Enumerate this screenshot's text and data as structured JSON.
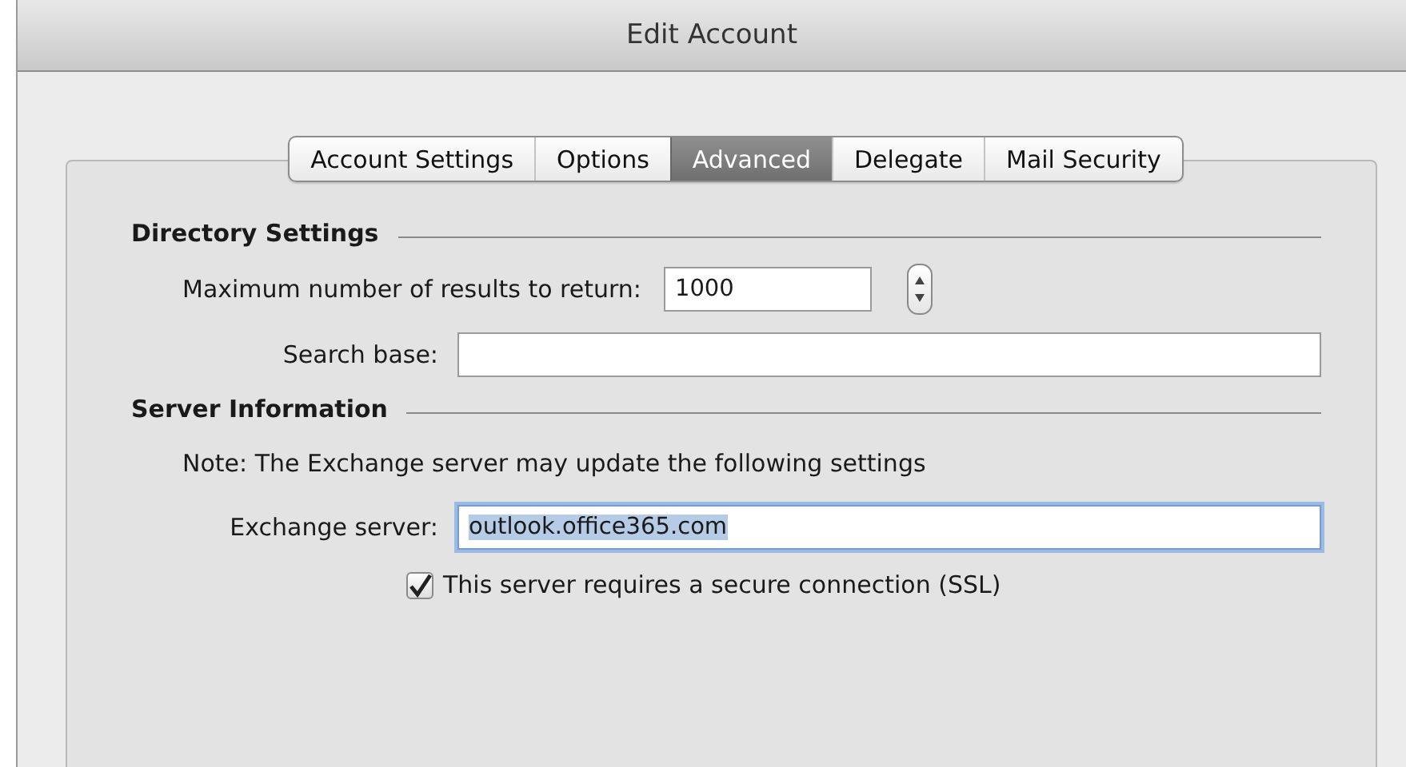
{
  "window": {
    "title": "Edit Account"
  },
  "tabs": [
    {
      "label": "Account Settings",
      "selected": false
    },
    {
      "label": "Options",
      "selected": false
    },
    {
      "label": "Advanced",
      "selected": true
    },
    {
      "label": "Delegate",
      "selected": false
    },
    {
      "label": "Mail Security",
      "selected": false
    }
  ],
  "sections": [
    {
      "title": "Directory Settings",
      "rows": [
        {
          "kind": "stepper",
          "label": "Maximum number of results to return:",
          "value": "1000"
        },
        {
          "kind": "field",
          "label": "Search base:"
        }
      ]
    },
    {
      "title": "Server Information",
      "rows": [
        {
          "kind": "note",
          "text": "Note: The Exchange server may update the following settings"
        },
        {
          "kind": "field",
          "label": "Exchange server:",
          "value": "outlook.office365.com",
          "focused": true
        },
        {
          "kind": "checkbox",
          "label": "This server requires a secure connection (SSL)",
          "checked": true
        }
      ]
    }
  ]
}
